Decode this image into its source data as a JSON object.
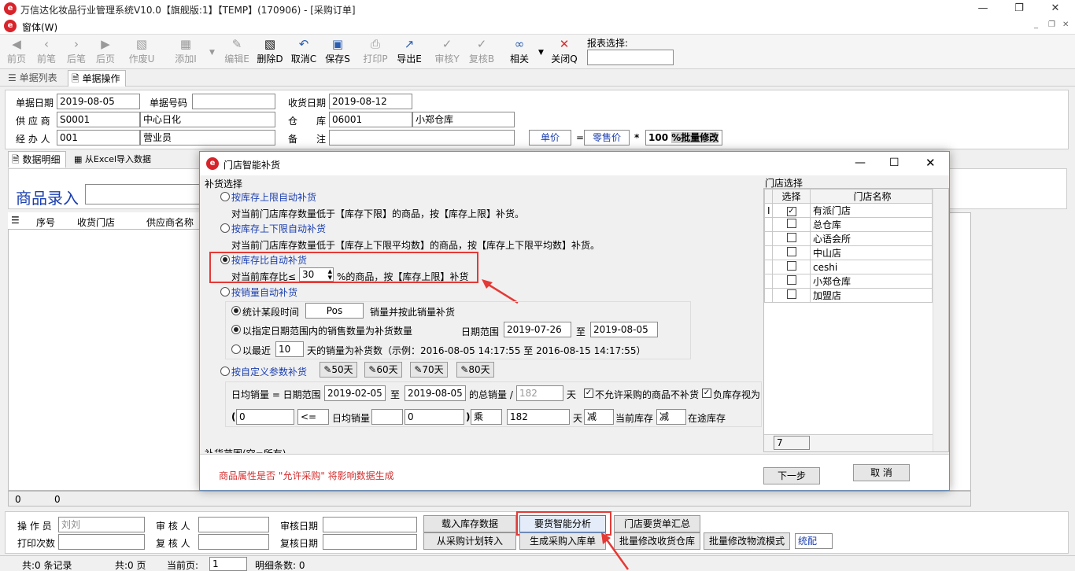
{
  "window": {
    "title": "万信达化妆品行业管理系统V10.0【旗舰版:1】【TEMP】(170906) - [采购订单]",
    "menu": "窗体(W)"
  },
  "toolbar": {
    "buttons": [
      {
        "label": "前页",
        "icon": "first-page-icon"
      },
      {
        "label": "前笔",
        "icon": "prev-record-icon"
      },
      {
        "label": "后笔",
        "icon": "next-record-icon"
      },
      {
        "label": "后页",
        "icon": "last-page-icon"
      },
      {
        "label": "作废U",
        "icon": "void-icon"
      },
      {
        "label": "添加I",
        "icon": "add-icon"
      },
      {
        "label": "编辑E",
        "icon": "edit-icon"
      },
      {
        "label": "删除D",
        "icon": "delete-icon"
      },
      {
        "label": "取消C",
        "icon": "undo-icon"
      },
      {
        "label": "保存S",
        "icon": "save-icon"
      },
      {
        "label": "打印P",
        "icon": "print-icon"
      },
      {
        "label": "导出E",
        "icon": "export-icon"
      },
      {
        "label": "审核Y",
        "icon": "approve-icon"
      },
      {
        "label": "复核B",
        "icon": "recheck-icon"
      },
      {
        "label": "相关",
        "icon": "link-icon"
      },
      {
        "label": "关闭Q",
        "icon": "close-icon"
      }
    ],
    "report_label": "报表选择:",
    "report_value": ""
  },
  "tabs": [
    "单据列表",
    "单据操作"
  ],
  "header_form": {
    "doc_date_label": "单据日期",
    "doc_date": "2019-08-05",
    "doc_no_label": "单据号码",
    "doc_no": "",
    "recv_date_label": "收货日期",
    "recv_date": "2019-08-12",
    "supplier_label": "供 应 商",
    "supplier_code": "S0001",
    "supplier_name": "中心日化",
    "warehouse_label": "仓　　库",
    "warehouse_code": "06001",
    "warehouse_name": "小郑仓库",
    "handler_label": "经 办 人",
    "handler_code": "001",
    "handler_name": "营业员",
    "remark_label": "备　　注",
    "remark": "",
    "price_label": "单价",
    "eq": "=",
    "retail_label": "零售价",
    "times": "*",
    "pct_value": "100",
    "batch_modify": "%批量修改"
  },
  "subtabs": [
    "数据明细",
    "从Excel导入数据"
  ],
  "product_entry_label": "商品录入",
  "grid_columns": [
    "序号",
    "收货门店",
    "供应商名称"
  ],
  "grid_footer": [
    "0",
    "0"
  ],
  "bottom_form": {
    "operator_label": "操 作 员",
    "operator": "刘刘",
    "auditor_label": "审 核 人",
    "auditor": "",
    "audit_date_label": "审核日期",
    "audit_date": "",
    "print_count_label": "打印次数",
    "print_count": "",
    "rechecker_label": "复 核 人",
    "rechecker": "",
    "recheck_date_label": "复核日期",
    "recheck_date": "",
    "buttons": [
      "载入库存数据",
      "要货智能分析",
      "门店要货单汇总",
      "从采购计划转入",
      "生成采购入库单",
      "批量修改收货仓库",
      "批量修改物流模式",
      "统配"
    ]
  },
  "status": {
    "total_records": "共:0 条记录",
    "total_pages": "共:0 页",
    "current_page_label": "当前页:",
    "current_page": "1",
    "detail_count": "明细条数: 0"
  },
  "dialog": {
    "title": "门店智能补货",
    "section_label": "补货选择",
    "options": [
      {
        "label": "按库存上限自动补货",
        "desc": "对当前门店库存数量低于【库存下限】的商品，按【库存上限】补货。"
      },
      {
        "label": "按库存上下限自动补货",
        "desc": "对当前门店库存数量低于【库存上下限平均数】的商品，按【库存上下限平均数】补货。"
      },
      {
        "label": "按库存比自动补货",
        "desc_pre": "对当前库存比≤",
        "ratio": "30",
        "desc_post": "%的商品，按【库存上限】补货"
      },
      {
        "label": "按销量自动补货"
      }
    ],
    "sales": {
      "stat_label": "统计某段时间",
      "pos_value": "Pos",
      "stat_suffix": "销量并按此销量补货",
      "range_label": "以指定日期范围内的销售数量为补货数量",
      "date_range_label": "日期范围",
      "date_from": "2019-07-26",
      "to": "至",
      "date_to": "2019-08-05",
      "recent_pre": "以最近",
      "recent_days": "10",
      "recent_post": "天的销量为补货数（示例：2016-08-05 14:17:55 至 2016-08-15 14:17:55）"
    },
    "custom": {
      "label": "按自定义参数补货",
      "preset_buttons": [
        "50天",
        "60天",
        "70天",
        "80天"
      ],
      "daily_label": "日均销量 = 日期范围",
      "from": "2019-02-05",
      "to": "至",
      "until": "2019-08-05",
      "total_label": "的总销量 /",
      "days_value": "182",
      "days_unit": "天",
      "no_purchase_label": "不允许采购的商品不补货",
      "neg_stock_label": "负库存视为",
      "expr": {
        "open": "(",
        "v1": "0",
        "op": "<=",
        "mid_label": "日均销量",
        "v2": "",
        "v3": "0",
        "close": ")",
        "mul": "乘",
        "days": "182",
        "days_unit": "天",
        "minus1": "减",
        "cur_stock": "当前库存",
        "minus2": "减",
        "transit": "在途库存"
      }
    },
    "range_label": "补货范围(空=所有)",
    "store_panel": {
      "title": "门店选择",
      "col_select": "选择",
      "col_name": "门店名称",
      "stores": [
        {
          "name": "有派门店",
          "checked": true
        },
        {
          "name": "总仓库",
          "checked": false
        },
        {
          "name": "心语会所",
          "checked": false
        },
        {
          "name": "中山店",
          "checked": false
        },
        {
          "name": "ceshi",
          "checked": false
        },
        {
          "name": "小郑仓库",
          "checked": false
        },
        {
          "name": "加盟店",
          "checked": false
        }
      ],
      "count": "7"
    },
    "note": "商品属性是否 \"允许采购\" 将影响数据生成",
    "next_button": "下一步",
    "cancel_button": "取 消"
  },
  "colors": {
    "highlight": "#e53935",
    "link_blue": "#1b3fb0",
    "note_red": "#d32f2f"
  }
}
